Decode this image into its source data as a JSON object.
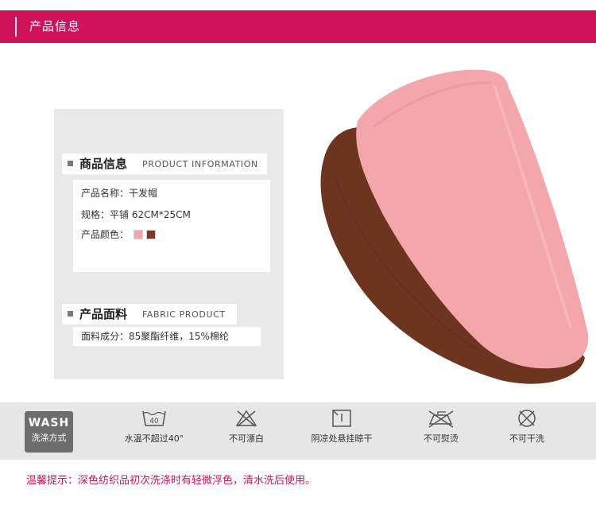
{
  "header": {
    "title": "产品信息",
    "color": "#d0125b"
  },
  "product_info": {
    "heading_cn": "商品信息",
    "heading_en": "PRODUCT INFORMATION",
    "name_row": "产品名称：干发帽",
    "spec_row": "规格：平铺 62CM*25CM",
    "color_label": "产品颜色：",
    "colors": [
      "#f3a7ab",
      "#7a3a26"
    ]
  },
  "fabric": {
    "heading_cn": "产品面料",
    "heading_en": "FABRIC PRODUCT",
    "composition": "面料成分：85聚酯纤维，15%棉纶"
  },
  "product_image": {
    "colors": [
      "#f3a7ab",
      "#6d3420"
    ]
  },
  "wash": {
    "badge_top": "WASH",
    "badge_bottom": "洗涤方式",
    "items": [
      {
        "icon": "wash-40-icon",
        "label": "水温不超过40°",
        "icon_text": "40"
      },
      {
        "icon": "no-bleach-icon",
        "label": "不可漂白"
      },
      {
        "icon": "shade-dry-icon",
        "label": "阴凉处悬挂晾干"
      },
      {
        "icon": "no-iron-icon",
        "label": "不可熨烫"
      },
      {
        "icon": "no-dry-clean-icon",
        "label": "不可干洗"
      }
    ]
  },
  "tip": "温馨提示：深色纺织品初次洗涤时有轻微浮色，清水洗后使用。"
}
